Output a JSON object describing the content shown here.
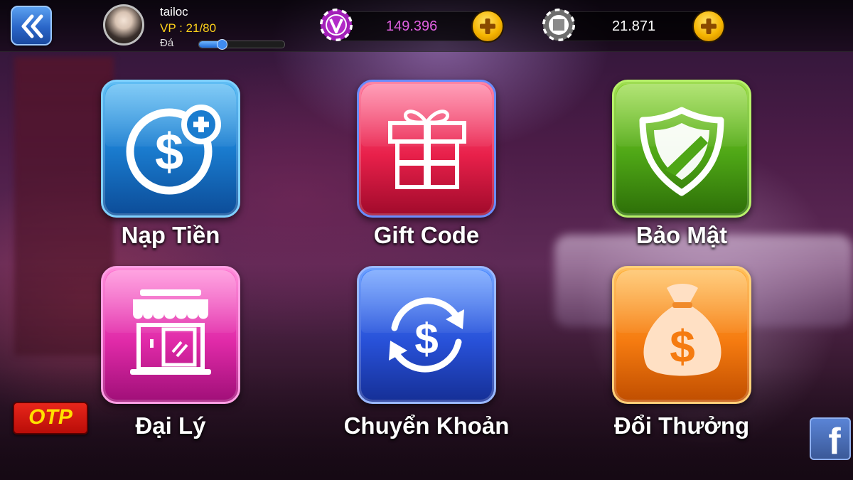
{
  "player": {
    "username": "tailoc",
    "vp_label": "VP : 21/80",
    "rank": "Đá",
    "vp_progress": 0.2625
  },
  "currency": {
    "vcoin": {
      "value": "149.396",
      "color": "#e060e0"
    },
    "chip": {
      "value": "21.871",
      "color": "#ffffff"
    }
  },
  "menu": {
    "items": [
      {
        "id": "nap-tien",
        "label": "Nạp Tiền",
        "icon": "dollar-plus-icon"
      },
      {
        "id": "gift-code",
        "label": "Gift Code",
        "icon": "gift-icon"
      },
      {
        "id": "bao-mat",
        "label": "Bảo Mật",
        "icon": "shield-icon"
      },
      {
        "id": "dai-ly",
        "label": "Đại Lý",
        "icon": "storefront-icon"
      },
      {
        "id": "chuyen-khoan",
        "label": "Chuyển Khoản",
        "icon": "dollar-transfer-icon"
      },
      {
        "id": "doi-thuong",
        "label": "Đổi Thưởng",
        "icon": "money-bag-icon"
      }
    ]
  },
  "otp": {
    "label": "OTP"
  },
  "facebook": {
    "label": "f"
  },
  "colors": {
    "vp": "#ffd21a",
    "accent_plus": "#f5b400",
    "otp_bg": "#c8140c",
    "otp_text": "#ffe000",
    "facebook": "#3b5998"
  }
}
